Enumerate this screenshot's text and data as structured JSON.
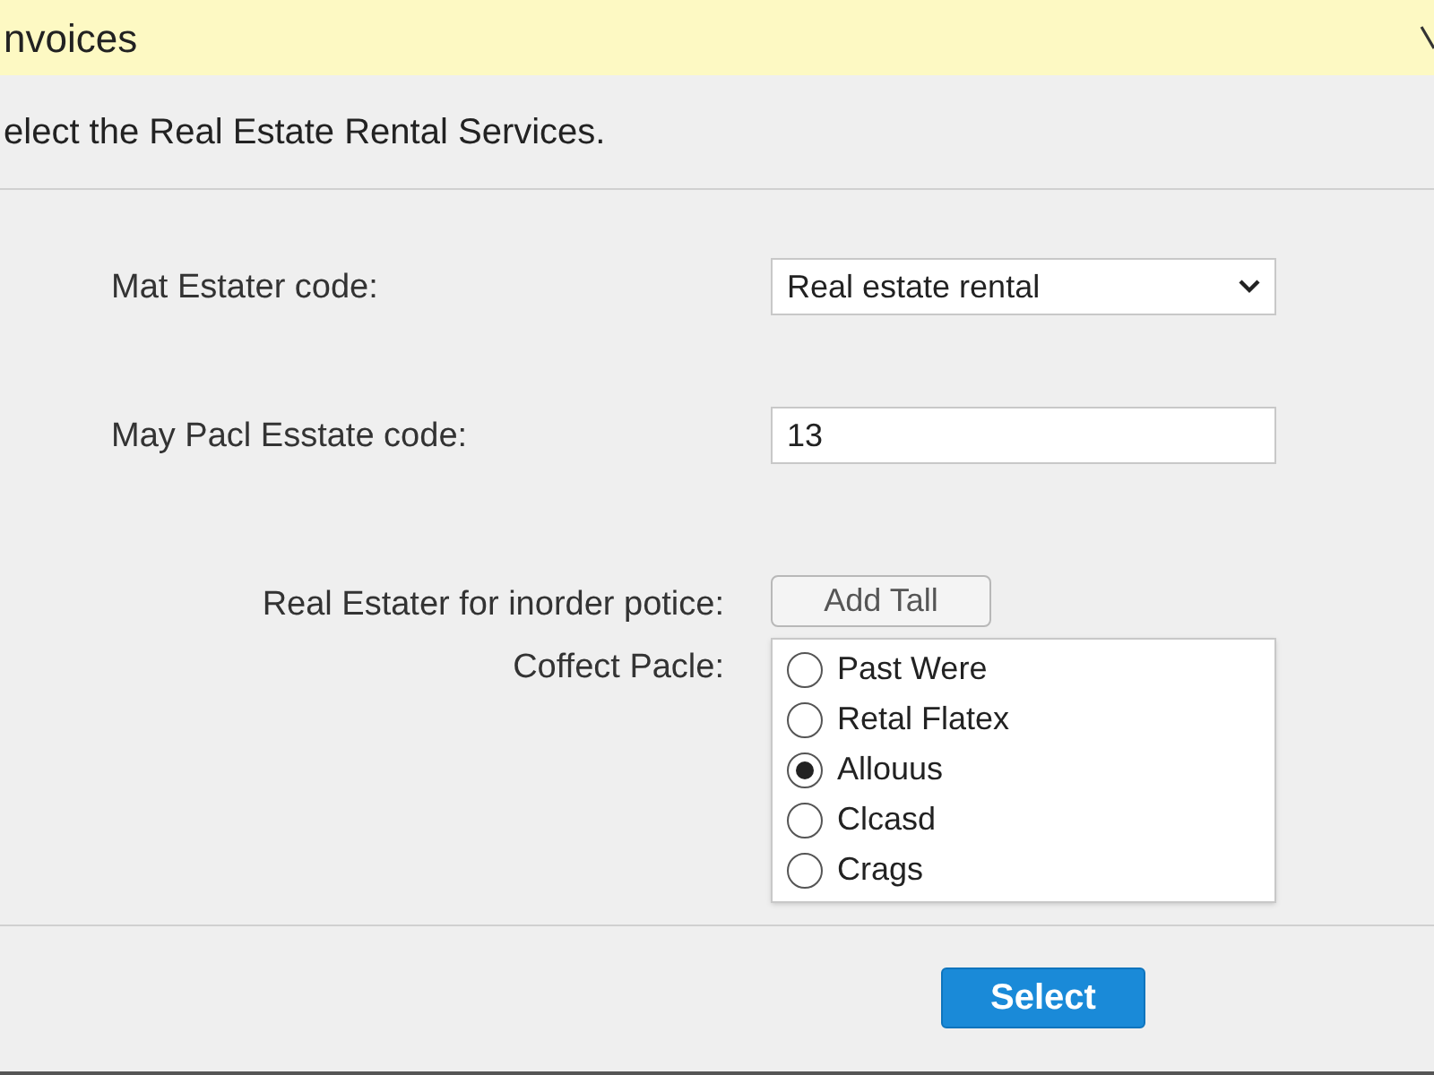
{
  "window": {
    "title": "nvoices"
  },
  "description": "elect the Real Estate Rental Services.",
  "fields": [
    {
      "kind": "dropdown",
      "label": "Mat Estater code:",
      "value": "Real estate rental"
    },
    {
      "kind": "text",
      "label": "May Pacl Esstate code:",
      "value": "13"
    },
    {
      "kind": "button",
      "label": "Real Estater for inorder potice:",
      "value": "Add Tall"
    },
    {
      "kind": "radio",
      "label": "Coffect Pacle:",
      "options": [
        {
          "label": "Past Were",
          "selected": false
        },
        {
          "label": "Retal Flatex",
          "selected": false
        },
        {
          "label": "Allouus",
          "selected": true
        },
        {
          "label": "Clcasd",
          "selected": false
        },
        {
          "label": "Crags",
          "selected": false
        }
      ]
    }
  ],
  "buttons": [
    {
      "label": "Select"
    }
  ]
}
